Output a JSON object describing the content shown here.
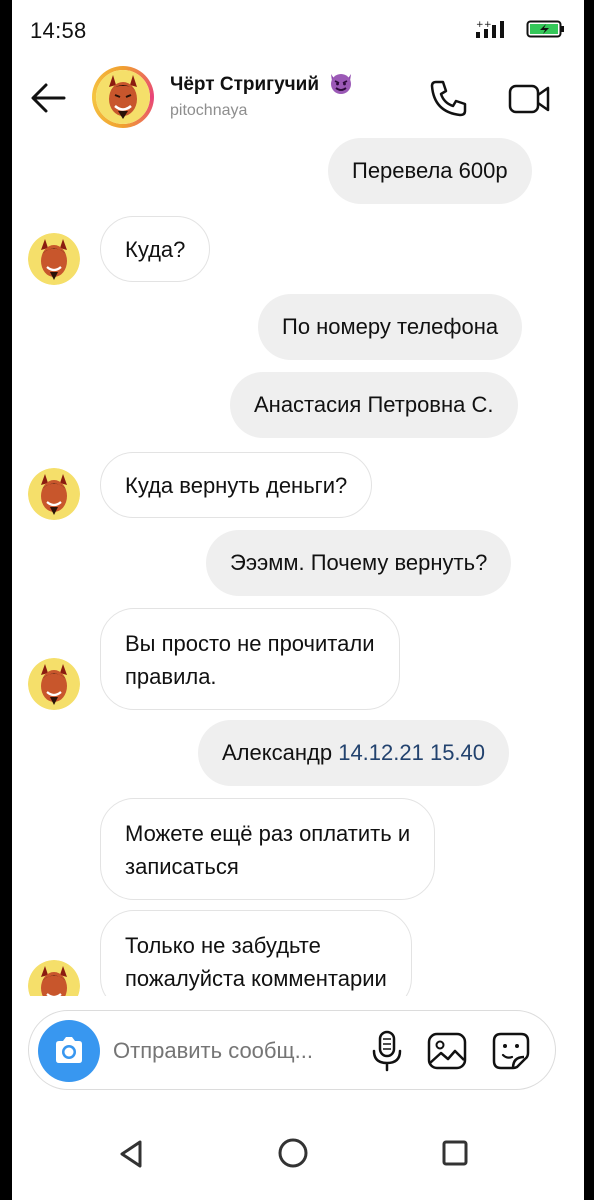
{
  "status_bar": {
    "time": "14:58"
  },
  "header": {
    "contact_name": "Чёрт Стригучий",
    "username": "pitochnaya"
  },
  "messages": [
    {
      "direction": "outgoing",
      "text": "Перевела 600р"
    },
    {
      "direction": "incoming",
      "text": "Куда?"
    },
    {
      "direction": "outgoing",
      "text": "По номеру телефона"
    },
    {
      "direction": "outgoing",
      "text": "Анастасия Петровна С."
    },
    {
      "direction": "incoming",
      "text": "Куда вернуть деньги?"
    },
    {
      "direction": "outgoing",
      "text": "Эээмм. Почему вернуть?"
    },
    {
      "direction": "incoming",
      "lines": [
        "Вы просто не прочитали",
        "правила."
      ]
    },
    {
      "direction": "outgoing",
      "text": "Александр",
      "link": "14.12.21 15.40"
    },
    {
      "direction": "incoming",
      "lines": [
        "Можете ещё раз оплатить и",
        "записаться"
      ]
    },
    {
      "direction": "incoming",
      "lines": [
        "Только не забудьте",
        "пожалуйста комментарии"
      ]
    }
  ],
  "composer": {
    "placeholder": "Отправить сообщ..."
  },
  "colors": {
    "outgoing_bubble": "#efefef",
    "camera_button": "#3897f0",
    "link": "#22426e",
    "battery_fill": "#34c759"
  },
  "icons": {
    "back": "arrow-left-icon",
    "call": "phone-icon",
    "video": "video-camera-icon",
    "camera": "camera-icon",
    "mic": "microphone-icon",
    "gallery": "image-icon",
    "sticker": "sticker-icon"
  }
}
